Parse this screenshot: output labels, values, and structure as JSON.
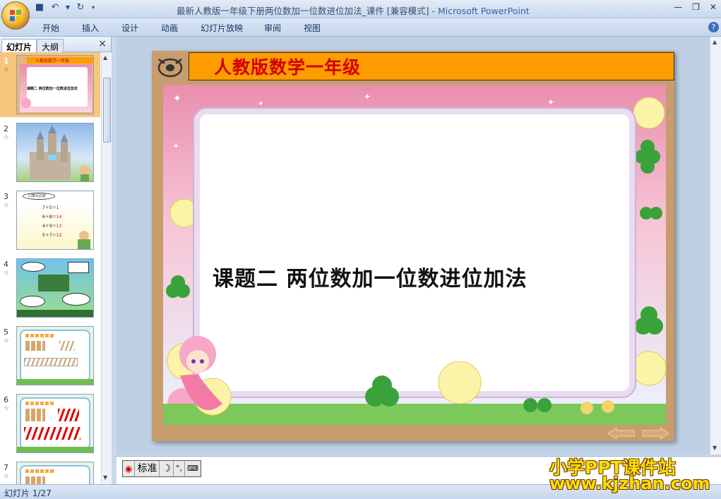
{
  "window": {
    "title": "最新人教版一年级下册两位数加一位数进位加法_课件 [兼容模式]",
    "separator": " - ",
    "app_name": "Microsoft PowerPoint"
  },
  "ribbon": {
    "tabs": [
      "开始",
      "插入",
      "设计",
      "动画",
      "幻灯片放映",
      "审阅",
      "视图"
    ]
  },
  "left_pane": {
    "tab_slides": "幻灯片",
    "tab_outline": "大纲",
    "close": "×",
    "thumbnails": [
      {
        "num": "1",
        "selected": true,
        "header": "人教版数学一年级",
        "title": "课题二 两位数加一位数进位加法"
      },
      {
        "num": "2",
        "selected": false
      },
      {
        "num": "3",
        "selected": false,
        "banner": "口算大比拼",
        "lines": [
          [
            "7＋5＝",
            "1"
          ],
          [
            "6＋8＝",
            "14"
          ],
          [
            "4＋9＝",
            "13"
          ],
          [
            "5＋7＝",
            "12"
          ]
        ]
      },
      {
        "num": "4",
        "selected": false
      },
      {
        "num": "5",
        "selected": false
      },
      {
        "num": "6",
        "selected": false
      },
      {
        "num": "7",
        "selected": false
      }
    ]
  },
  "slide": {
    "header": "人教版数学一年级",
    "title": "课题二  两位数加一位数进位加法"
  },
  "ime": {
    "mode": "标准"
  },
  "status": {
    "slide_counter": "幻灯片 1/27"
  },
  "watermark": {
    "line1": "小学PPT课件站",
    "line2": "www.kjzhan.com"
  },
  "colors": {
    "slide_header_bg": "#ff9c00",
    "slide_header_text": "#d10000",
    "selected_thumb": "#f8c57c",
    "watermark": "#ffde00"
  }
}
